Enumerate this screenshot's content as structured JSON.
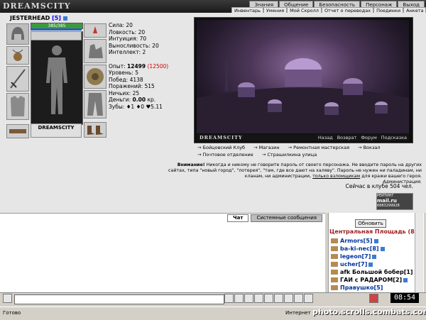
{
  "app": {
    "logo": "DREAMSCITY"
  },
  "top_nav": [
    "Знания",
    "Общение",
    "Безопасность",
    "Персонаж",
    "Выход"
  ],
  "sub_nav": [
    "Инвентарь",
    "Умения",
    "Мой Скролл",
    "Отчет о переводах",
    "Поединки",
    "Анкета"
  ],
  "character": {
    "name": "JESTERHEAD",
    "level": "[5]",
    "hp": "385/385",
    "doll_logo": "DREAMSCITY"
  },
  "stats": {
    "strength": "Сила: 20",
    "agility": "Ловкость: 20",
    "intuition": "Интуиция: 70",
    "endurance": "Выносливость: 20",
    "intellect": "Интеллект: 2",
    "exp_label": "Опыт:",
    "exp_value": "12499",
    "exp_next": "(12500)",
    "level_line": "Уровень: 5",
    "wins": "Побед: 4138",
    "losses": "Поражений: 515",
    "draws": "Ничьих: 25",
    "money_label": "Деньги:",
    "money_value": "0.00",
    "money_unit": "кр.",
    "teeth": "Зубы: ♦1 ♦0 ♥5.11"
  },
  "game": {
    "logo": "DREAMSCITY",
    "links": [
      "Назад",
      "Возврат",
      "Форум",
      "Подсказка"
    ]
  },
  "locations": [
    "Бойцовский Клуб",
    "Магазин",
    "Ремонтная мастерская",
    "Вокзал",
    "Почтовое отделение",
    "Страшилкина улица"
  ],
  "warning": {
    "bold": "Внимание!",
    "text": "Никогда и никому не говорите пароль от своего персонажа. Не вводите пароль на других сайтах, типа \"новый город\", \"лотерея\", \"там, где все дают на халяву\". Пароль не нужен ни паладинам, ни кланам, ни администрации,",
    "link": "только взломщикам",
    "tail": "для кражи вашего героя.",
    "sign": "Администрация."
  },
  "online": "Сейчас в клубе 504 чел.",
  "counter": {
    "line1": "РЕЙТИНГ",
    "line2": "mail.ru",
    "line3": "6883299928"
  },
  "chat": {
    "tabs": [
      "Чат",
      "Системные сообщения"
    ],
    "input_value": ""
  },
  "room": {
    "refresh_label": "Обновить",
    "title": "Центральная Площадь (8)",
    "users": [
      {
        "name": "Armors[5]"
      },
      {
        "name": "ba-ki-nec[8]"
      },
      {
        "name": "legeon[7]"
      },
      {
        "name": "ucher[7]"
      },
      {
        "name": "afk Большой бобер[1]"
      },
      {
        "name": "ГАИ с РАДАРОМ[2]"
      },
      {
        "name": "Правушко[5]"
      }
    ]
  },
  "clock": "08:54",
  "status": {
    "ready": "Готово",
    "zone": "Интернет"
  },
  "watermark": "photo.scrolls.combats.com"
}
